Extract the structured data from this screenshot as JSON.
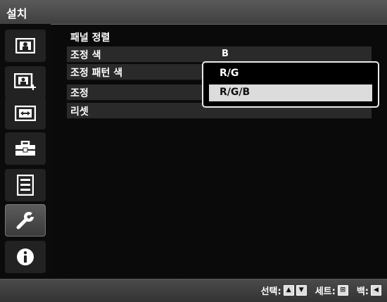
{
  "window": {
    "title": "설치"
  },
  "sidebar": {
    "items": [
      {
        "icon": "picture-icon"
      },
      {
        "icon": "picture-add-icon"
      },
      {
        "icon": "display-icon"
      },
      {
        "icon": "toolbox-icon"
      },
      {
        "icon": "checklist-icon"
      },
      {
        "icon": "wrench-icon",
        "active": true
      },
      {
        "icon": "info-icon"
      }
    ]
  },
  "main": {
    "section_title": "패널 정렬",
    "rows": [
      {
        "label": "조정 색",
        "value": "B"
      },
      {
        "label": "조정 패턴 색",
        "value": ""
      },
      {
        "label": "조정",
        "value": ""
      },
      {
        "label": "리셋",
        "value": ""
      }
    ]
  },
  "dropdown": {
    "options": [
      "R/G",
      "R/G/B"
    ],
    "selected": "R/G/B"
  },
  "footer": {
    "select_label": "선택:",
    "set_label": "세트:",
    "back_label": "백:"
  }
}
